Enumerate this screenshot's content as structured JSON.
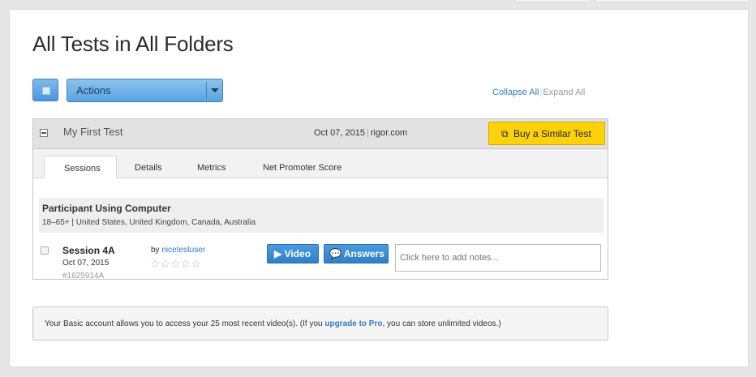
{
  "page": {
    "title": "All Tests in All Folders"
  },
  "toolbar": {
    "actions_label": "Actions",
    "collapse_all": "Collapse All",
    "separator": "|",
    "expand_all": "Expand All"
  },
  "test": {
    "name": "My First Test",
    "date": "Oct 07, 2015",
    "date_separator": "|",
    "site": "rigor.com",
    "buy_icon": "copy-icon",
    "buy_label": "Buy a Similar Test",
    "tabs": [
      {
        "label": "Sessions",
        "active": true
      },
      {
        "label": "Details",
        "active": false
      },
      {
        "label": "Metrics",
        "active": false
      },
      {
        "label": "Net Promoter Score",
        "active": false
      }
    ],
    "participant": {
      "title": "Participant Using Computer",
      "demographics": "18–65+ | United States, United Kingdom, Canada, Australia"
    },
    "session": {
      "name": "Session 4A",
      "date": "Oct 07, 2015",
      "id": "#1625914A",
      "by_label": "by",
      "user": "nicetestuser",
      "rating": 0,
      "rating_max": 5,
      "stars_text": "☆☆☆☆☆",
      "video_label": "▶ Video",
      "answers_label": "💬 Answers",
      "notes_placeholder": "Click here to add notes..."
    }
  },
  "notice": {
    "before": "Your Basic account allows you to access your 25 most recent video(s). (If you ",
    "link": "upgrade to Pro",
    "after": ", you can store unlimited videos.)"
  },
  "colors": {
    "accent_blue": "#2e7cc4",
    "buy_yellow": "#fdd20a",
    "header_gray": "#e2e2e2"
  }
}
